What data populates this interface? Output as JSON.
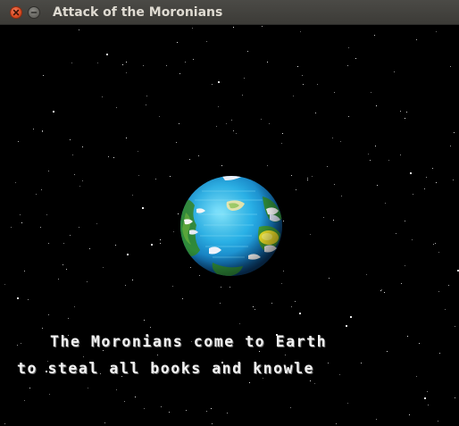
{
  "window": {
    "title": "Attack of the Moronians",
    "buttons": [
      "close-icon",
      "minimize-icon"
    ]
  },
  "scene": {
    "background": "#000000",
    "planet": "earth",
    "story_lines": [
      "The Moronians come to Earth",
      "to steal all books and knowle"
    ],
    "text_color": "#f2f2f2"
  }
}
